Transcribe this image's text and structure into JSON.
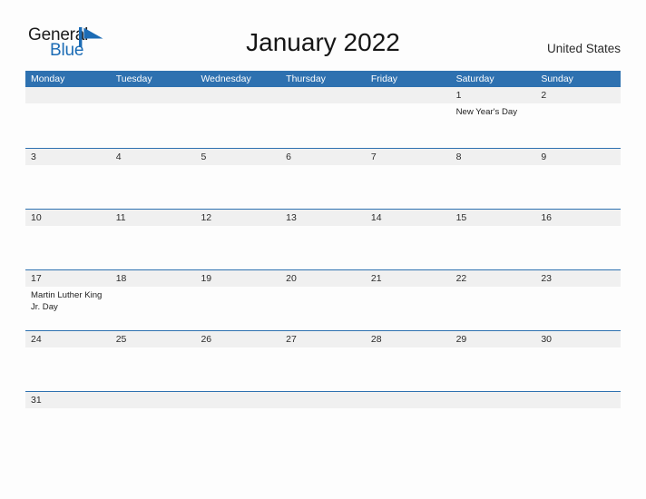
{
  "brand": {
    "name_part1": "General",
    "name_part2": "Blue",
    "mark_icon": "flag-triangle-icon",
    "accent_color": "#1c6cb5"
  },
  "header": {
    "title": "January 2022",
    "country": "United States"
  },
  "colors": {
    "header_blue": "#2e71b0",
    "row_band_gray": "#f0f0f0",
    "rule_blue": "#2e71b0",
    "text": "#1f1f1f"
  },
  "calendar": {
    "month": "January",
    "year": "2022",
    "weekday_headers": [
      "Monday",
      "Tuesday",
      "Wednesday",
      "Thursday",
      "Friday",
      "Saturday",
      "Sunday"
    ],
    "weeks": [
      {
        "days": [
          {
            "number": "",
            "event": ""
          },
          {
            "number": "",
            "event": ""
          },
          {
            "number": "",
            "event": ""
          },
          {
            "number": "",
            "event": ""
          },
          {
            "number": "",
            "event": ""
          },
          {
            "number": "1",
            "event": "New Year's Day"
          },
          {
            "number": "2",
            "event": ""
          }
        ]
      },
      {
        "days": [
          {
            "number": "3",
            "event": ""
          },
          {
            "number": "4",
            "event": ""
          },
          {
            "number": "5",
            "event": ""
          },
          {
            "number": "6",
            "event": ""
          },
          {
            "number": "7",
            "event": ""
          },
          {
            "number": "8",
            "event": ""
          },
          {
            "number": "9",
            "event": ""
          }
        ]
      },
      {
        "days": [
          {
            "number": "10",
            "event": ""
          },
          {
            "number": "11",
            "event": ""
          },
          {
            "number": "12",
            "event": ""
          },
          {
            "number": "13",
            "event": ""
          },
          {
            "number": "14",
            "event": ""
          },
          {
            "number": "15",
            "event": ""
          },
          {
            "number": "16",
            "event": ""
          }
        ]
      },
      {
        "days": [
          {
            "number": "17",
            "event": "Martin Luther King Jr. Day"
          },
          {
            "number": "18",
            "event": ""
          },
          {
            "number": "19",
            "event": ""
          },
          {
            "number": "20",
            "event": ""
          },
          {
            "number": "21",
            "event": ""
          },
          {
            "number": "22",
            "event": ""
          },
          {
            "number": "23",
            "event": ""
          }
        ]
      },
      {
        "days": [
          {
            "number": "24",
            "event": ""
          },
          {
            "number": "25",
            "event": ""
          },
          {
            "number": "26",
            "event": ""
          },
          {
            "number": "27",
            "event": ""
          },
          {
            "number": "28",
            "event": ""
          },
          {
            "number": "29",
            "event": ""
          },
          {
            "number": "30",
            "event": ""
          }
        ]
      },
      {
        "days": [
          {
            "number": "31",
            "event": ""
          },
          {
            "number": "",
            "event": ""
          },
          {
            "number": "",
            "event": ""
          },
          {
            "number": "",
            "event": ""
          },
          {
            "number": "",
            "event": ""
          },
          {
            "number": "",
            "event": ""
          },
          {
            "number": "",
            "event": ""
          }
        ]
      }
    ]
  }
}
